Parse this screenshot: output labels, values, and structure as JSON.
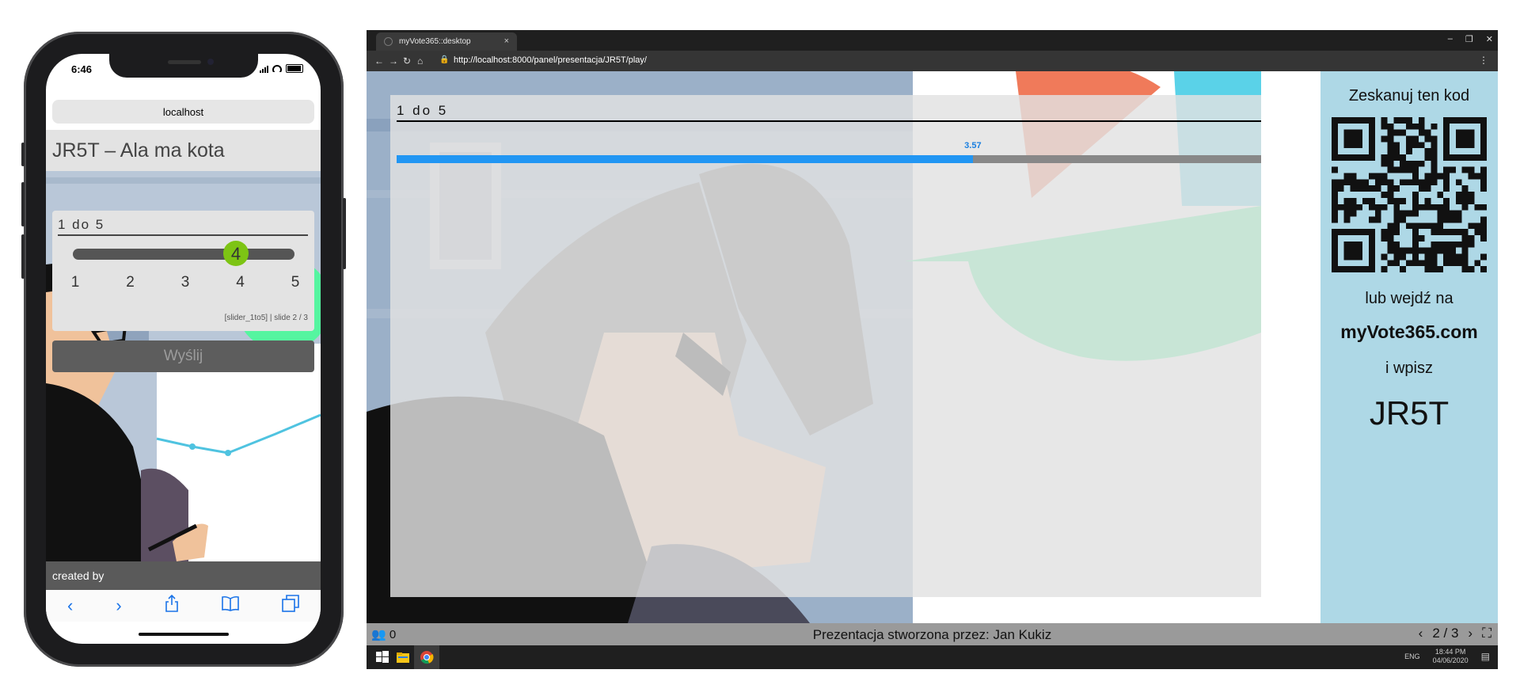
{
  "phone": {
    "time": "6:46",
    "url": "localhost",
    "title": "JR5T – Ala ma kota",
    "question": "1 do 5",
    "slider": {
      "value": "4",
      "min": 1,
      "max": 5,
      "ticks": [
        "1",
        "2",
        "3",
        "4",
        "5"
      ]
    },
    "slide_info": "[slider_1to5] | slide 2 / 3",
    "send_label": "Wyślij",
    "created_by": "created by",
    "toolbar_icons": [
      "back-icon",
      "forward-icon",
      "share-icon",
      "bookmarks-icon",
      "tabs-icon"
    ]
  },
  "browser": {
    "tab_title": "myVote365::desktop",
    "url": "http://localhost:8000/panel/presentacja/JR5T/play/"
  },
  "presentation": {
    "question": "1 do 5",
    "result_value": "3.57",
    "result_fraction": 0.643,
    "sidebar": {
      "scan": "Zeskanuj ten kod",
      "or_go": "lub wejdź na",
      "site": "myVote365.com",
      "enter": "i wpisz",
      "code": "JR5T"
    },
    "participants": "0",
    "author": "Prezentacja stworzona przez: Jan Kukiz",
    "pagination": "2 / 3"
  },
  "taskbar": {
    "lang": "ENG",
    "time": "18:44 PM",
    "date": "04/06/2020"
  },
  "colors": {
    "accent_bar": "#2196f3",
    "slider_thumb": "#7dc414",
    "sidebar_bg": "#aed8e6"
  }
}
